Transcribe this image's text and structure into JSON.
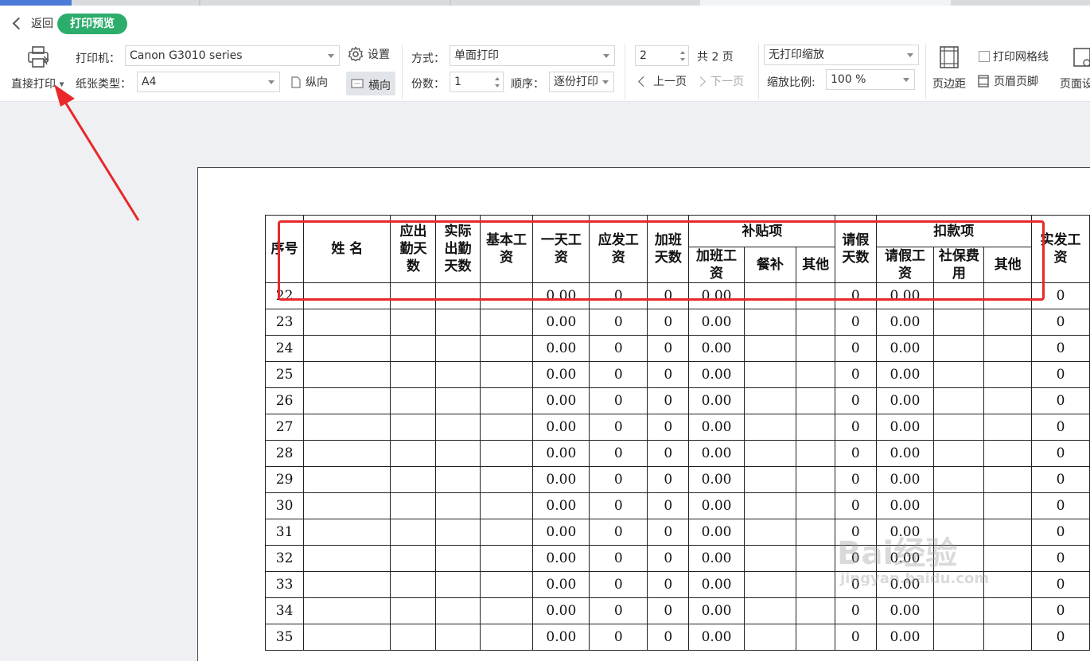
{
  "toolbar": {
    "back_label": "返回",
    "preview_label": "打印预览",
    "direct_print_label": "直接打印",
    "printer_label": "打印机：",
    "printer_value": "Canon G3010 series",
    "settings_label": "设置",
    "paper_label": "纸张类型：",
    "paper_value": "A4",
    "portrait_label": "纵向",
    "landscape_label": "横向",
    "mode_label": "方式：",
    "mode_value": "单面打印",
    "copies_label": "份数：",
    "copies_value": "1",
    "order_label": "顺序：",
    "order_value": "逐份打印",
    "page_input": "2",
    "total_pages": "共 2 页",
    "prev_label": "上一页",
    "next_label": "下一页",
    "scale_mode": "无打印缩放",
    "scale_label": "缩放比例:",
    "scale_value": "100 %",
    "margin_label": "页边距",
    "gridlines_label": "打印网格线",
    "header_footer_label": "页眉页脚",
    "page_setup_label": "页面设"
  },
  "table": {
    "headers": {
      "seq": "序号",
      "name": "姓  名",
      "should_days": "应出勤天数",
      "actual_days": "实际出勤天数",
      "base_salary": "基本工资",
      "daily_wage": "一天工资",
      "gross_pay": "应发工资",
      "ot_days": "加班天数",
      "allowance_group": "补贴项",
      "ot_pay": "加班工资",
      "meal": "餐补",
      "other1": "其他",
      "leave_days": "请假天数",
      "deduction_group": "扣款项",
      "leave_pay": "请假工资",
      "social": "社保费用",
      "other2": "其他",
      "net_pay": "实发工资"
    },
    "rows": [
      {
        "seq": "22",
        "daily": "0.00",
        "gross": "0",
        "ot": "0",
        "otpay": "0.00",
        "leave": "0",
        "leavepay": "0.00",
        "net": "0"
      },
      {
        "seq": "23",
        "daily": "0.00",
        "gross": "0",
        "ot": "0",
        "otpay": "0.00",
        "leave": "0",
        "leavepay": "0.00",
        "net": "0"
      },
      {
        "seq": "24",
        "daily": "0.00",
        "gross": "0",
        "ot": "0",
        "otpay": "0.00",
        "leave": "0",
        "leavepay": "0.00",
        "net": "0"
      },
      {
        "seq": "25",
        "daily": "0.00",
        "gross": "0",
        "ot": "0",
        "otpay": "0.00",
        "leave": "0",
        "leavepay": "0.00",
        "net": "0"
      },
      {
        "seq": "26",
        "daily": "0.00",
        "gross": "0",
        "ot": "0",
        "otpay": "0.00",
        "leave": "0",
        "leavepay": "0.00",
        "net": "0"
      },
      {
        "seq": "27",
        "daily": "0.00",
        "gross": "0",
        "ot": "0",
        "otpay": "0.00",
        "leave": "0",
        "leavepay": "0.00",
        "net": "0"
      },
      {
        "seq": "28",
        "daily": "0.00",
        "gross": "0",
        "ot": "0",
        "otpay": "0.00",
        "leave": "0",
        "leavepay": "0.00",
        "net": "0"
      },
      {
        "seq": "29",
        "daily": "0.00",
        "gross": "0",
        "ot": "0",
        "otpay": "0.00",
        "leave": "0",
        "leavepay": "0.00",
        "net": "0"
      },
      {
        "seq": "30",
        "daily": "0.00",
        "gross": "0",
        "ot": "0",
        "otpay": "0.00",
        "leave": "0",
        "leavepay": "0.00",
        "net": "0"
      },
      {
        "seq": "31",
        "daily": "0.00",
        "gross": "0",
        "ot": "0",
        "otpay": "0.00",
        "leave": "0",
        "leavepay": "0.00",
        "net": "0"
      },
      {
        "seq": "32",
        "daily": "0.00",
        "gross": "0",
        "ot": "0",
        "otpay": "0.00",
        "leave": "0",
        "leavepay": "0.00",
        "net": "0"
      },
      {
        "seq": "33",
        "daily": "0.00",
        "gross": "0",
        "ot": "0",
        "otpay": "0.00",
        "leave": "0",
        "leavepay": "0.00",
        "net": "0"
      },
      {
        "seq": "34",
        "daily": "0.00",
        "gross": "0",
        "ot": "0",
        "otpay": "0.00",
        "leave": "0",
        "leavepay": "0.00",
        "net": "0"
      },
      {
        "seq": "35",
        "daily": "0.00",
        "gross": "0",
        "ot": "0",
        "otpay": "0.00",
        "leave": "0",
        "leavepay": "0.00",
        "net": "0"
      }
    ]
  },
  "watermark": {
    "brand": "Bai经验",
    "url": "jingyan.baidu.com"
  },
  "colors": {
    "accent": "#2dad6c",
    "annotation": "#e8282a"
  }
}
